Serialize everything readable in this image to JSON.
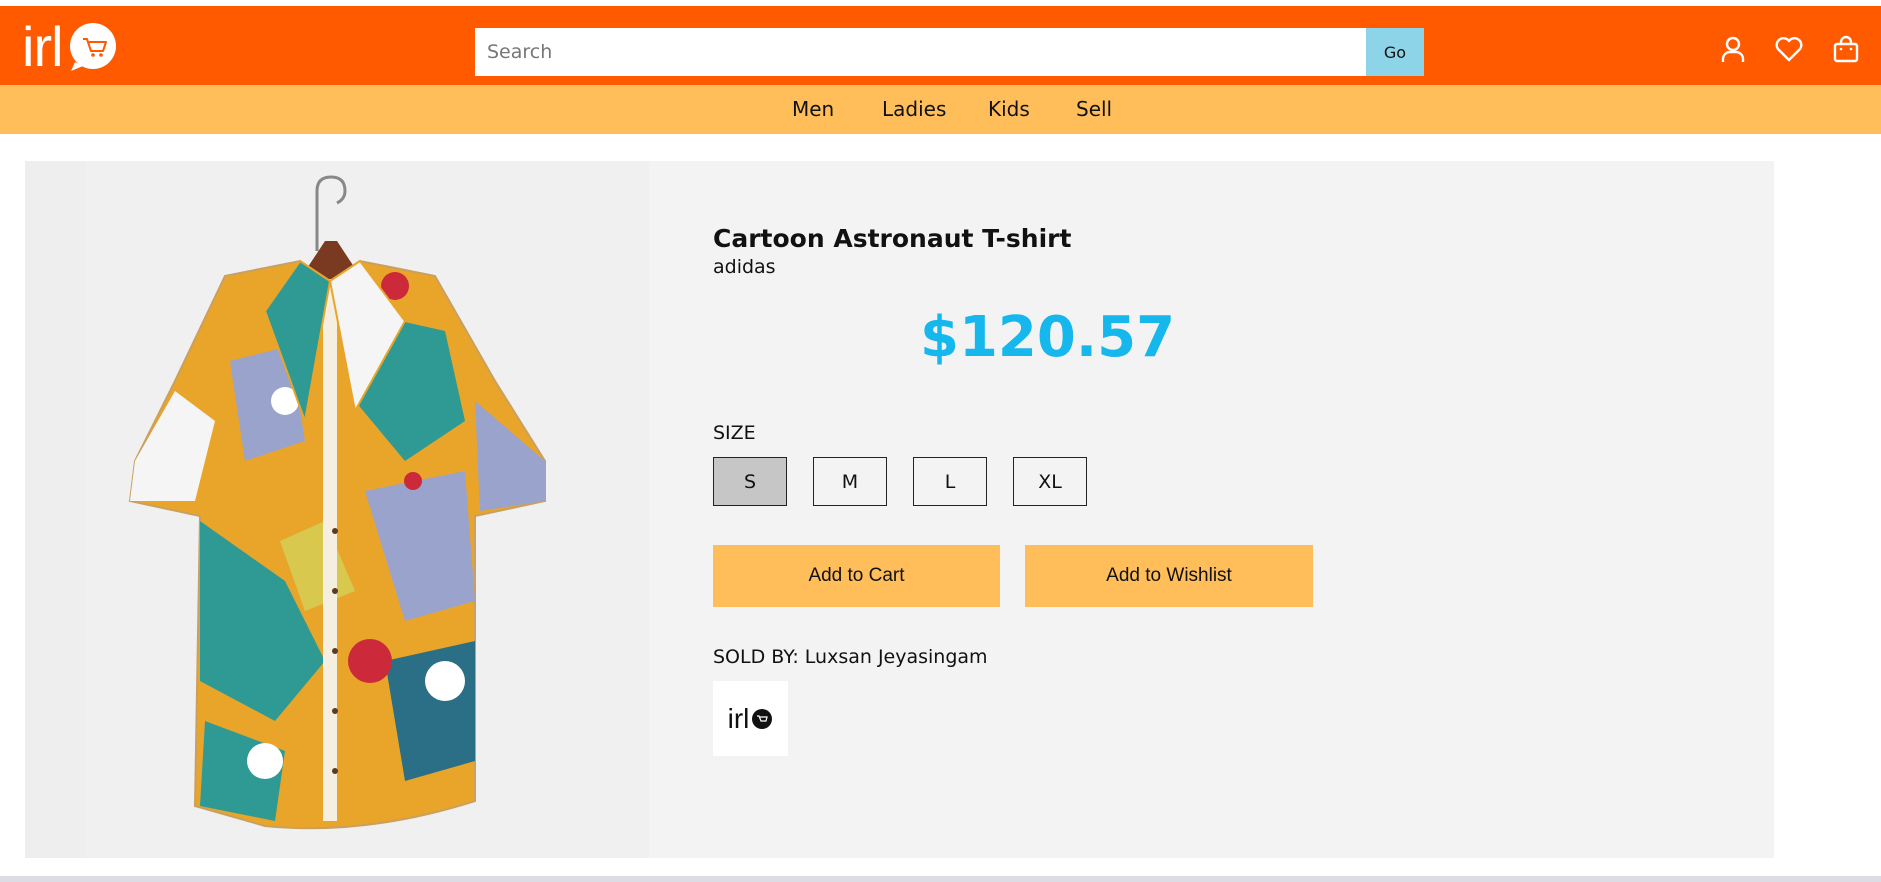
{
  "header": {
    "logo_text": "irl",
    "search_placeholder": "Search",
    "search_value": "",
    "go_label": "Go",
    "icons": [
      "account-icon",
      "heart-icon",
      "shopping-bag-icon"
    ]
  },
  "nav": {
    "items": [
      {
        "label": "Men"
      },
      {
        "label": "Ladies"
      },
      {
        "label": "Kids"
      },
      {
        "label": "Sell"
      }
    ]
  },
  "product": {
    "title": "Cartoon Astronaut T-shirt",
    "brand": "adidas",
    "price": "$120.57",
    "size_label": "SIZE",
    "sizes": [
      "S",
      "M",
      "L",
      "XL"
    ],
    "selected_size": "S",
    "add_to_cart_label": "Add to Cart",
    "add_to_wishlist_label": "Add to Wishlist",
    "sold_by_label": "SOLD BY: Luxsan Jeyasingam",
    "seller_logo_text": "irl"
  },
  "colors": {
    "header_bg": "#ff5a00",
    "nav_bg": "#ffbe5a",
    "price": "#15b7ec",
    "go_button": "#8dd4e8"
  }
}
